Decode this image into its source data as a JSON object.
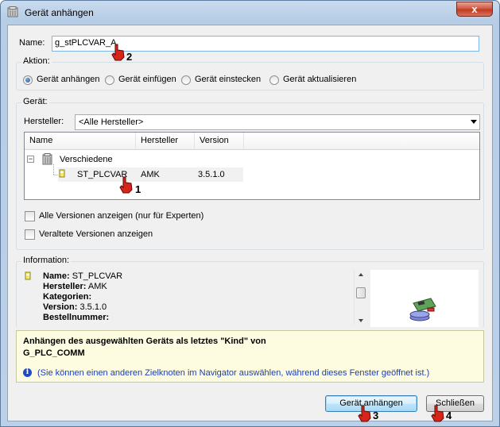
{
  "window": {
    "title": "Gerät anhängen",
    "close": "x"
  },
  "name_field": {
    "label": "Name:",
    "value": "g_stPLCVAR_A"
  },
  "aktion": {
    "label": "Aktion:",
    "options": [
      "Gerät anhängen",
      "Gerät einfügen",
      "Gerät einstecken",
      "Gerät aktualisieren"
    ],
    "selected": "Gerät anhängen"
  },
  "geraet": {
    "label": "Gerät:",
    "hersteller_label": "Hersteller:",
    "hersteller_value": "<Alle Hersteller>",
    "columns": [
      "Name",
      "Hersteller",
      "Version"
    ],
    "tree": {
      "folder": "Verschiedene",
      "expander": "−",
      "device": {
        "name": "ST_PLCVAR",
        "vendor": "AMK",
        "version": "3.5.1.0"
      }
    },
    "checkboxes": [
      "Alle Versionen anzeigen (nur für Experten)",
      "Veraltete Versionen anzeigen"
    ]
  },
  "information": {
    "label": "Information:",
    "name_key": "Name:",
    "name_val": "ST_PLCVAR",
    "hersteller_key": "Hersteller:",
    "hersteller_val": "AMK",
    "kategorien_key": "Kategorien:",
    "version_key": "Version:",
    "version_val": "3.5.1.0",
    "bestellnummer_key": "Bestellnummer:"
  },
  "description": {
    "line1": "Anhängen des ausgewählten Geräts als letztes \"Kind\" von",
    "line2": "G_PLC_COMM",
    "info_glyph": "i",
    "hint": "(Sie können einen anderen Zielknoten im Navigator auswählen, während dieses Fenster geöffnet ist.)"
  },
  "buttons": {
    "attach": "Gerät anhängen",
    "close": "Schließen"
  },
  "markers": [
    "1",
    "2",
    "3",
    "4"
  ],
  "colors": {
    "hint": "#1a3fb5",
    "desc_bg": "#fdfce0",
    "hand": "#d8251a"
  }
}
